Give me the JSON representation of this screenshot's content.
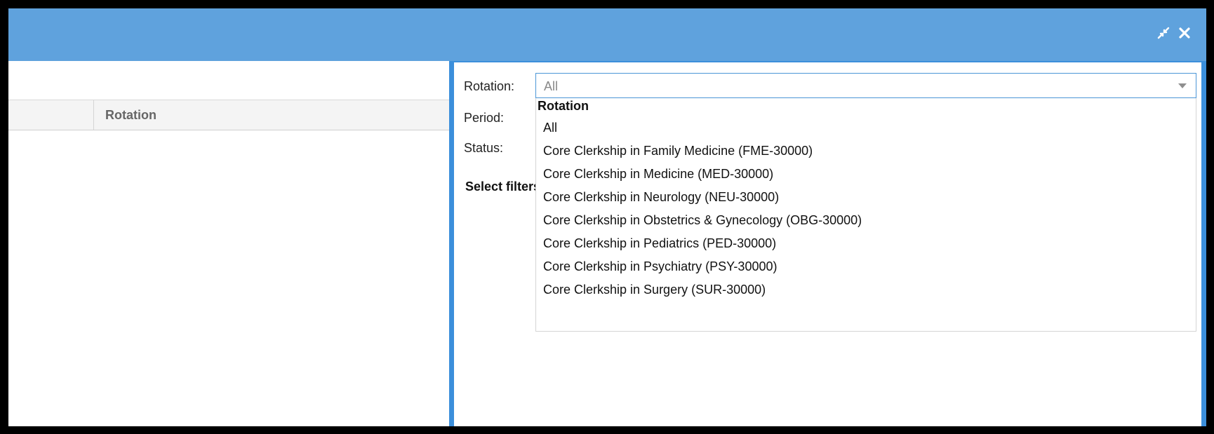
{
  "window": {
    "minimize_icon": "collapse-arrows-icon",
    "close_icon": "close-icon"
  },
  "grid": {
    "rotation_header": "Rotation"
  },
  "filters": {
    "labels": {
      "rotation": "Rotation:",
      "period": "Period:",
      "status": "Status:"
    },
    "select_filters_text": "Select filters",
    "rotation_select": {
      "selected_value": "All",
      "dropdown_header": "Rotation",
      "options": [
        "All",
        "Core Clerkship in Family Medicine (FME-30000)",
        "Core Clerkship in Medicine (MED-30000)",
        "Core Clerkship in Neurology (NEU-30000)",
        "Core Clerkship in Obstetrics & Gynecology (OBG-30000)",
        "Core Clerkship in Pediatrics (PED-30000)",
        "Core Clerkship in Psychiatry (PSY-30000)",
        "Core Clerkship in Surgery (SUR-30000)"
      ]
    }
  },
  "colors": {
    "titlebar": "#5fa2dd",
    "panel_border": "#3b8fdb",
    "combo_border": "#4b96d6"
  }
}
